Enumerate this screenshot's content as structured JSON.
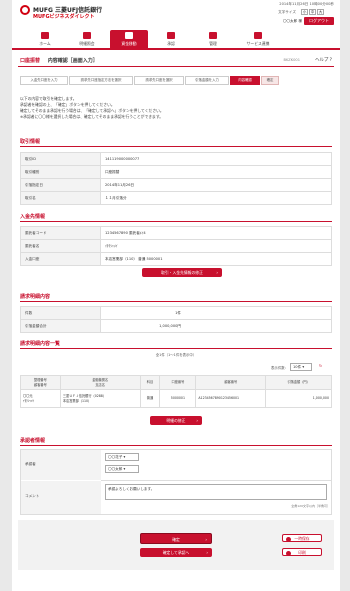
{
  "header": {
    "bank_name": "MUFG 三菱UFJ信託銀行",
    "service_name": "MUFGビジネスダイレクト",
    "datetime": "2014年11月26日 10時00分00秒",
    "text_size_label": "文字サイズ",
    "text_size_options": [
      "小",
      "中",
      "大"
    ],
    "user_label": "〇〇太郎 様",
    "logout_label": "ログアウト"
  },
  "nav": [
    {
      "label": "ホーム",
      "icon": "home-icon"
    },
    {
      "label": "明細照会",
      "icon": "document-icon"
    },
    {
      "label": "資金移動",
      "icon": "transfer-icon",
      "active": true
    },
    {
      "label": "承認",
      "icon": "approval-icon"
    },
    {
      "label": "管理",
      "icon": "settings-icon"
    },
    {
      "label": "サービス連携",
      "icon": "link-icon"
    }
  ],
  "page": {
    "category": "口座振替",
    "title": "内容確認［画面入力］",
    "screen_id": "BKZK001",
    "help_label": "ヘルプ"
  },
  "steps": [
    "入金先口座を入力",
    "請求先口座指定方法を選択",
    "請求先口座を選択",
    "引落金額を入力",
    "内容確認",
    "確定"
  ],
  "notice": [
    "以下の内容で取引を確定します。",
    "承認者を確認の上、「確定」ボタンを押してください。",
    "確定してそのまま承認を行う場合は、「確定して承認へ」ボタンを押してください。",
    "※承認者に〇〇様を選択した場合は、確定してそのまま承認を行うことができます。"
  ],
  "transaction": {
    "title": "取引情報",
    "rows": [
      {
        "label": "取引ID",
        "value": "141119000000077"
      },
      {
        "label": "取引種別",
        "value": "口座振替"
      },
      {
        "label": "引落指定日",
        "value": "2014年11月26日"
      },
      {
        "label": "取引名",
        "value": "１１月引落分"
      }
    ]
  },
  "deposit": {
    "title": "入金先情報",
    "rows": [
      {
        "label": "委託者コード",
        "value": "1234567890 委託者ﾒｲ4"
      },
      {
        "label": "委託者名",
        "value": "ｲﾀｸｼｬﾒｲ"
      },
      {
        "label": "入金口座",
        "value": "本店営業部（110） 普通 5000001"
      }
    ],
    "button_label": "取引・入金先情報の修正"
  },
  "billing": {
    "title": "請求明細内容",
    "rows": [
      {
        "label": "件数",
        "value": "1件"
      },
      {
        "label": "引落金額合計",
        "value": "1,000,000円"
      }
    ]
  },
  "detail_list": {
    "title": "請求明細内容一覧",
    "count_text": "全1件（1～1件を表示中）",
    "per_page_label": "表示件数：",
    "per_page_value": "10件",
    "headers": [
      "整理番号\n顧客番号",
      "金融機関名\n支店名",
      "科目",
      "口座番号",
      "顧客番号",
      "引落金額（円）"
    ],
    "row": [
      "〇〇元\nｲﾀｸｼｬﾒｲ",
      "三菱ＵＦＪ信託銀行（0288）\n本店営業部（110）",
      "普通",
      "5000001",
      "A1234567890123456001",
      "1,000,000"
    ],
    "button_label": "明細の修正"
  },
  "approver": {
    "title": "承認者情報",
    "approver_label": "承認者",
    "approver_1": "〇〇花子",
    "approver_2": "〇〇太郎",
    "comment_label": "コメント",
    "comment_value": "承認よろしくお願いします。",
    "comment_note": "全角120文字以内［半角可］"
  },
  "actions": {
    "confirm_label": "確定",
    "confirm_approve_label": "確定して承認へ",
    "save_label": "一時保存",
    "print_label": "印刷"
  }
}
